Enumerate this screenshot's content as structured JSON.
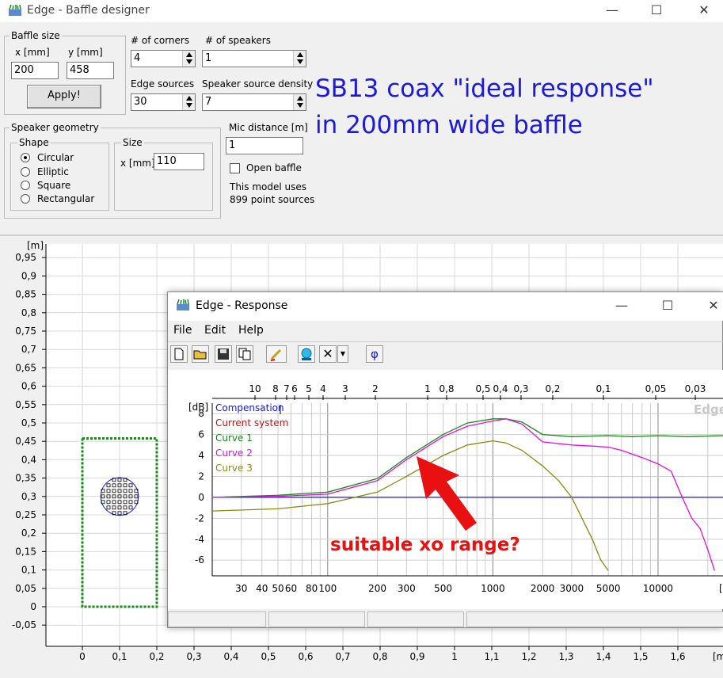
{
  "window": {
    "title": "Edge - Baffle designer"
  },
  "baffle_size": {
    "title": "Baffle size",
    "x_label": "x [mm]",
    "y_label": "y [mm]",
    "x_value": "200",
    "y_value": "458",
    "apply_label": "Apply!"
  },
  "corners": {
    "label": "# of corners",
    "value": "4"
  },
  "speakers": {
    "label": "# of speakers",
    "value": "1"
  },
  "edge_sources": {
    "label": "Edge sources",
    "value": "30"
  },
  "source_density": {
    "label": "Speaker source density",
    "value": "7"
  },
  "geometry": {
    "title": "Speaker geometry",
    "shape_title": "Shape",
    "shapes": [
      "Circular",
      "Elliptic",
      "Square",
      "Rectangular"
    ],
    "selected_shape": 0,
    "size_title": "Size",
    "size_label": "x [mm]",
    "size_value": "110"
  },
  "mic": {
    "label": "Mic distance [m]",
    "value": "1",
    "open_baffle_label": "Open baffle",
    "info_line1": "This model uses",
    "info_line2": "899 point sources"
  },
  "annotation": {
    "line1": "SB13 coax \"ideal response\"",
    "line2": "in 200mm wide baffle",
    "arrow_label": "suitable xo range?",
    "text_color": "#1a1ad8",
    "arrow_color": "#e81010"
  },
  "baffle_plot": {
    "y_unit": "[m]",
    "x_unit": "[m]",
    "y_ticks": [
      "0,95",
      "0,9",
      "0,85",
      "0,8",
      "0,75",
      "0,7",
      "0,65",
      "0,6",
      "0,55",
      "0,5",
      "0,45",
      "0,4",
      "0,35",
      "0,3",
      "0,25",
      "0,2",
      "0,15",
      "0,1",
      "0,05",
      "0",
      "-0,05"
    ],
    "x_ticks": [
      "0",
      "0,1",
      "0,2",
      "0,3",
      "0,4",
      "0,5",
      "0,6",
      "0,7",
      "0,8",
      "0,9",
      "1",
      "1,1",
      "1,2",
      "1,3",
      "1,4",
      "1,5",
      "1,6"
    ],
    "baffle_color": "#1a8a1a",
    "speaker_color": "#1a1ad8"
  },
  "response": {
    "title": "Edge - Response",
    "menu": [
      "File",
      "Edit",
      "Help"
    ],
    "toolbar_icons": [
      "new-file-icon",
      "open-folder-icon",
      "save-disk-icon",
      "copy-icon",
      "pen-icon",
      "globe-icon",
      "delete-x-icon",
      "dropdown-arrow-icon",
      "phi-icon"
    ],
    "phi_label": "φ",
    "watermark": "Edge",
    "window_buttons": [
      "—",
      "☐",
      "✕"
    ]
  },
  "chart_data": {
    "type": "line",
    "xscale": "log",
    "xlim": [
      20,
      25000
    ],
    "ylim": [
      -7.5,
      9
    ],
    "ylabel": "[dB]",
    "x_ticks": [
      30,
      40,
      50,
      60,
      80,
      100,
      200,
      300,
      500,
      1000,
      2000,
      3000,
      5000,
      10000
    ],
    "x_tick_labels": [
      "30",
      "40",
      "50",
      "60",
      "80",
      "100",
      "200",
      "300",
      "500",
      "1000",
      "2000",
      "3000",
      "5000",
      "10000"
    ],
    "y_ticks": [
      8,
      6,
      4,
      2,
      0,
      -2,
      -4,
      -6
    ],
    "y_tick_labels": [
      "8",
      "6",
      "4",
      "2",
      "0",
      "-2",
      "-4",
      "-6"
    ],
    "top_ticks": [
      "10",
      "8",
      "7",
      "6",
      "5",
      "4",
      "3",
      "2",
      "1",
      "0,8",
      "0,5",
      "0,4",
      "0,3",
      "0,2",
      "0,1",
      "0,05",
      "0,03"
    ],
    "series": [
      {
        "name": "Compensation",
        "color": "#1a1ad8",
        "x": [
          20,
          25000
        ],
        "y": [
          0,
          0
        ]
      },
      {
        "name": "Current system",
        "color": "#d01010",
        "x": [],
        "y": []
      },
      {
        "name": "Curve 1",
        "color": "#1a8a1a",
        "x": [
          20,
          50,
          100,
          200,
          300,
          500,
          700,
          1000,
          1200,
          1500,
          2000,
          3000,
          5000,
          7000,
          10000,
          15000,
          25000
        ],
        "y": [
          0,
          0.2,
          0.5,
          1.8,
          3.8,
          6.0,
          7.1,
          7.5,
          7.5,
          7.2,
          6.0,
          5.8,
          5.9,
          5.8,
          5.9,
          5.8,
          5.9
        ]
      },
      {
        "name": "Curve 2",
        "color": "#e010e0",
        "x": [
          20,
          50,
          100,
          200,
          300,
          500,
          700,
          1000,
          1200,
          1500,
          2000,
          3000,
          4000,
          5000,
          6000,
          8000,
          10000,
          12000,
          14000,
          16000,
          18000,
          20000,
          22000
        ],
        "y": [
          0,
          0.1,
          0.3,
          1.6,
          3.6,
          5.8,
          6.8,
          7.3,
          7.5,
          7.0,
          5.3,
          5.0,
          4.9,
          4.8,
          4.5,
          3.8,
          3.2,
          2.5,
          0,
          -2,
          -3,
          -5,
          -7
        ]
      },
      {
        "name": "Curve 3",
        "color": "#8a8a10",
        "x": [
          20,
          50,
          100,
          200,
          300,
          500,
          700,
          1000,
          1200,
          1500,
          2000,
          2500,
          3000,
          4000,
          4500,
          5000
        ],
        "y": [
          -1.3,
          -1.1,
          -0.6,
          0.5,
          2.0,
          4.0,
          5.0,
          5.4,
          5.2,
          4.5,
          3.0,
          1.6,
          0,
          -4,
          -6,
          -7
        ]
      }
    ]
  }
}
